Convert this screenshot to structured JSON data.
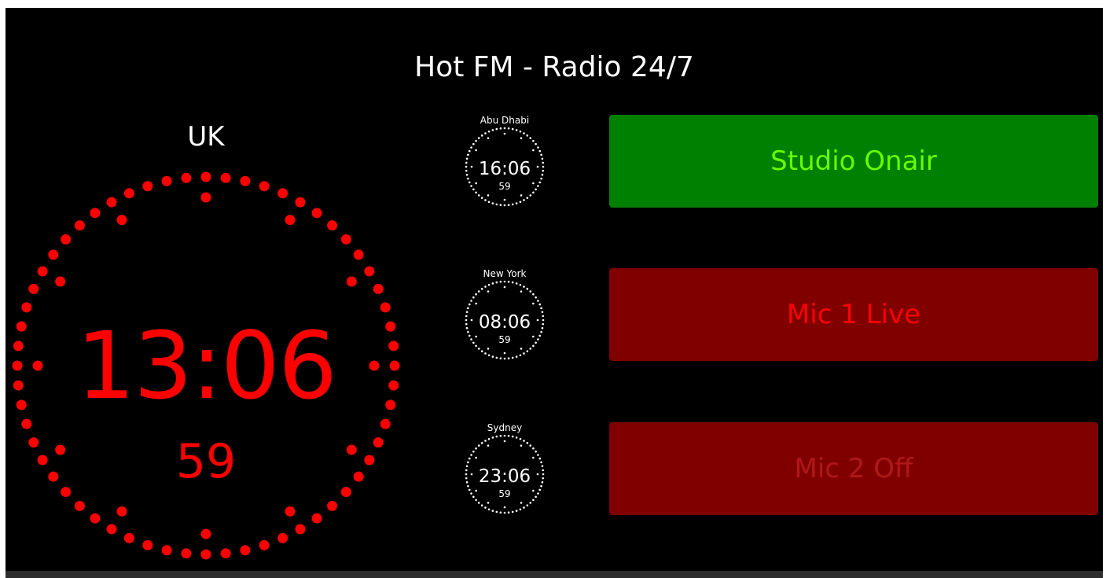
{
  "header": {
    "title": "Hot FM - Radio 24/7"
  },
  "main_clock": {
    "label": "UK",
    "time": "13:06",
    "seconds": "59",
    "color": "#ff0000"
  },
  "world_clocks": [
    {
      "city": "Abu Dhabi",
      "time": "16:06",
      "seconds": "59"
    },
    {
      "city": "New York",
      "time": "08:06",
      "seconds": "59"
    },
    {
      "city": "Sydney",
      "time": "23:06",
      "seconds": "59"
    }
  ],
  "status_panels": [
    {
      "label": "Studio Onair",
      "state": "on",
      "bg": "#008000",
      "fg": "#66ff00"
    },
    {
      "label": "Mic 1 Live",
      "state": "live",
      "bg": "#800000",
      "fg": "#ff0000"
    },
    {
      "label": "Mic 2 Off",
      "state": "off",
      "bg": "#800000",
      "fg": "#b01818"
    }
  ],
  "colors": {
    "background": "#000000",
    "text": "#ffffff",
    "bottom_bar": "#2d2d2d"
  }
}
